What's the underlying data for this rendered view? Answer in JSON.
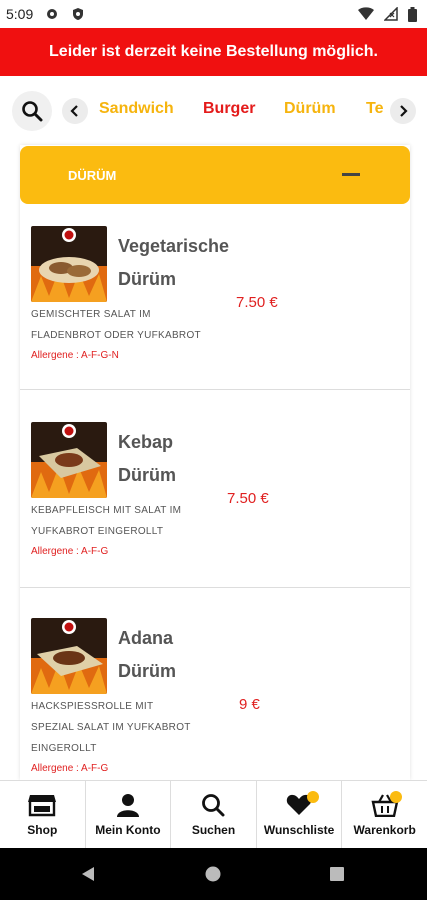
{
  "status_bar": {
    "time": "5:09"
  },
  "banner": {
    "text": "Leider ist derzeit keine Bestellung möglich."
  },
  "categories": [
    "Sandwich",
    "Burger",
    "Dürüm",
    "Te"
  ],
  "section": {
    "title": "DÜRÜM"
  },
  "products": [
    {
      "name_line1": "Vegetarische",
      "name_line2": "Dürüm",
      "desc_line1": "GEMISCHTER SALAT IM",
      "desc_line2": "FLADENBROT ODER YUFKABROT",
      "allergens": "Allergene : A-F-G-N",
      "price": "7.50 €"
    },
    {
      "name_line1": "Kebap",
      "name_line2": "Dürüm",
      "desc_line1": "KEBAPFLEISCH MIT SALAT IM",
      "desc_line2": "YUFKABROT EINGEROLLT",
      "allergens": "Allergene : A-F-G",
      "price": "7.50 €"
    },
    {
      "name_line1": "Adana",
      "name_line2": "Dürüm",
      "desc_line1": "HACKSPIESSROLLE MIT",
      "desc_line2": "SPEZIAL SALAT IM YUFKABROT",
      "desc_line3": "EINGEROLLT",
      "allergens": "Allergene : A-F-G",
      "price": "9 €"
    }
  ],
  "bottom_nav": [
    {
      "label": "Shop",
      "icon": "shop-icon"
    },
    {
      "label": "Mein Konto",
      "icon": "user-icon"
    },
    {
      "label": "Suchen",
      "icon": "search-icon"
    },
    {
      "label": "Wunschliste",
      "icon": "heart-icon"
    },
    {
      "label": "Warenkorb",
      "icon": "basket-icon"
    }
  ],
  "colors": {
    "banner": "#f01010",
    "accent_yellow": "#fbbb10",
    "price_red": "#e02020"
  }
}
